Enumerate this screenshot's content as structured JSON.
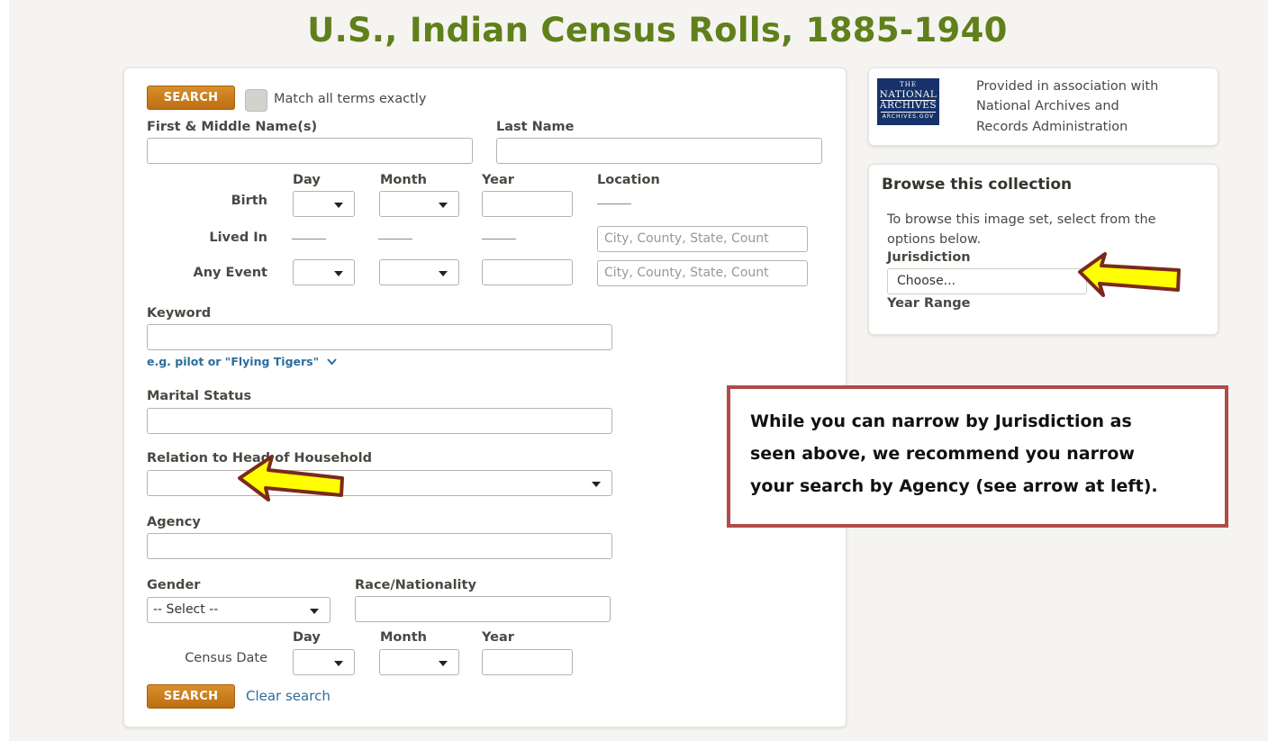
{
  "page": {
    "title": "U.S., Indian Census Rolls, 1885-1940"
  },
  "search_form": {
    "search_button": "SEARCH",
    "match_exactly_label": "Match all terms exactly",
    "first_middle_label": "First & Middle Name(s)",
    "last_name_label": "Last Name",
    "col_day": "Day",
    "col_month": "Month",
    "col_year": "Year",
    "col_location": "Location",
    "birth_label": "Birth",
    "lived_in_label": "Lived In",
    "any_event_label": "Any Event",
    "location_placeholder": "City, County, State, Count",
    "keyword_label": "Keyword",
    "keyword_hint": "e.g. pilot or \"Flying Tigers\"",
    "marital_status_label": "Marital Status",
    "relation_label": "Relation to Head of Household",
    "agency_label": "Agency",
    "gender_label": "Gender",
    "gender_value": "-- Select --",
    "race_label": "Race/Nationality",
    "census_date_label": "Census Date",
    "bottom_search_button": "SEARCH",
    "clear_search_link": "Clear search"
  },
  "sidebar": {
    "provider": {
      "logo_top": "THE",
      "logo_line1": "NATIONAL",
      "logo_line2": "ARCHIVES",
      "logo_bottom": "ARCHIVES.GOV",
      "text_line1": "Provided in association with",
      "text_line2": "National Archives and",
      "text_line3": "Records Administration"
    },
    "browse": {
      "heading": "Browse this collection",
      "description_line1": "To browse this image set, select from the",
      "description_line2": "options below.",
      "jurisdiction_label": "Jurisdiction",
      "jurisdiction_value": "Choose...",
      "year_range_label": "Year Range"
    }
  },
  "callout": {
    "line1": "While you can narrow by Jurisdiction as",
    "line2": "seen above, we recommend you narrow",
    "line3": "your search by Agency (see arrow at left)."
  },
  "colors": {
    "title_green": "#5f801a",
    "search_orange": "#c97c1e",
    "link_blue": "#2b6e9e",
    "callout_border": "#b24a4a",
    "arrow_fill": "#ffff00",
    "arrow_stroke": "#7a2a1c"
  }
}
